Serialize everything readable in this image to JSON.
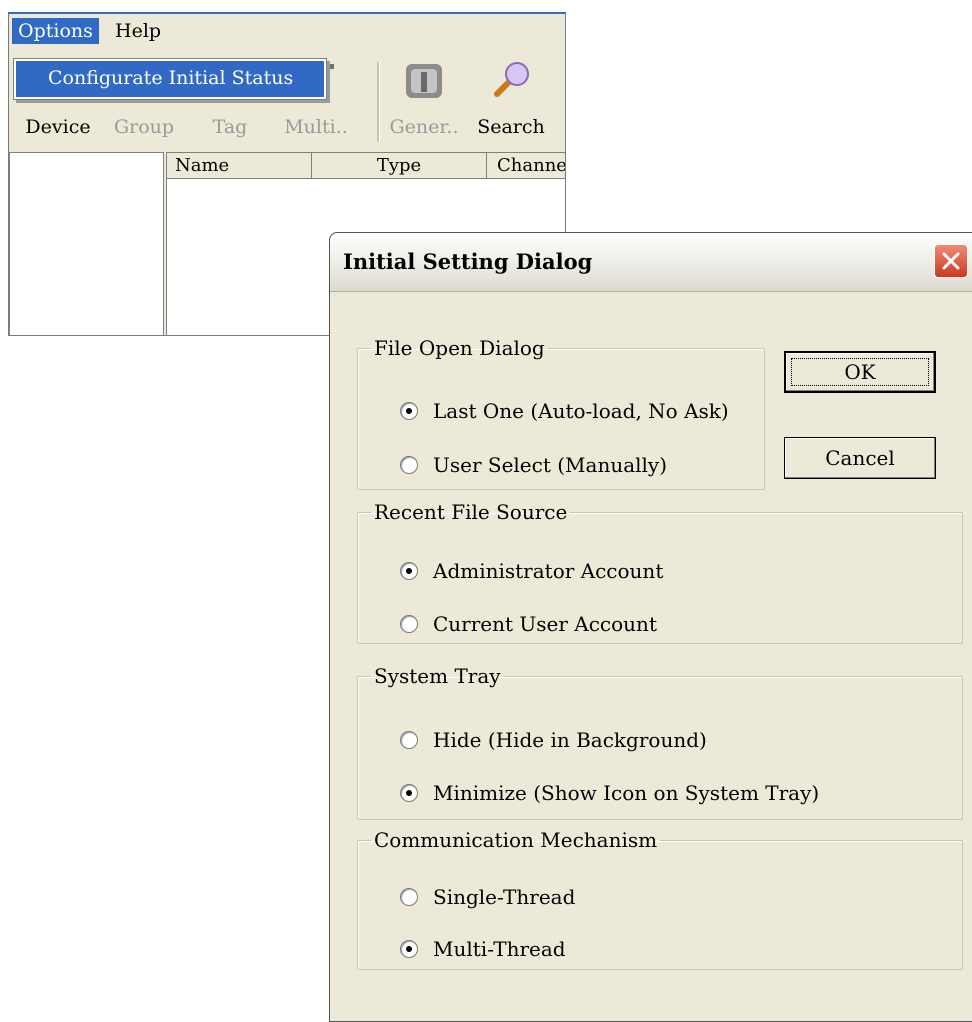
{
  "menubar": {
    "options": "Options",
    "help": "Help"
  },
  "dropdown": {
    "item": "Configurate Initial Status"
  },
  "toolbar": {
    "items": [
      {
        "label": "Device",
        "icon": "device-icon",
        "enabled": true
      },
      {
        "label": "Group",
        "icon": "group-icon",
        "enabled": false
      },
      {
        "label": "Tag",
        "icon": "tag-icon",
        "enabled": false
      },
      {
        "label": "Multi..",
        "icon": "multi-tag-icon",
        "enabled": false
      },
      {
        "label": "Gener..",
        "icon": "general-tools-icon",
        "enabled": false
      },
      {
        "label": "Search",
        "icon": "search-icon",
        "enabled": true
      }
    ]
  },
  "list": {
    "columns": [
      "Name",
      "Type",
      "Channe"
    ]
  },
  "dialog": {
    "title": "Initial Setting Dialog",
    "ok_label": "OK",
    "cancel_label": "Cancel",
    "groups": [
      {
        "legend": "File Open Dialog",
        "options": [
          {
            "label": "Last One (Auto-load, No Ask)",
            "checked": true
          },
          {
            "label": "User Select (Manually)",
            "checked": false
          }
        ]
      },
      {
        "legend": "Recent File Source",
        "options": [
          {
            "label": "Administrator Account",
            "checked": true
          },
          {
            "label": "Current User Account",
            "checked": false
          }
        ]
      },
      {
        "legend": "System Tray",
        "options": [
          {
            "label": "Hide (Hide in Background)",
            "checked": false
          },
          {
            "label": "Minimize (Show Icon on System Tray)",
            "checked": true
          }
        ]
      },
      {
        "legend": "Communication Mechanism",
        "options": [
          {
            "label": "Single-Thread",
            "checked": false
          },
          {
            "label": "Multi-Thread",
            "checked": true
          }
        ]
      }
    ]
  },
  "colors": {
    "menu_highlight": "#316ac5",
    "dialog_bg": "#ece9d8",
    "close_red": "#c9391f"
  }
}
